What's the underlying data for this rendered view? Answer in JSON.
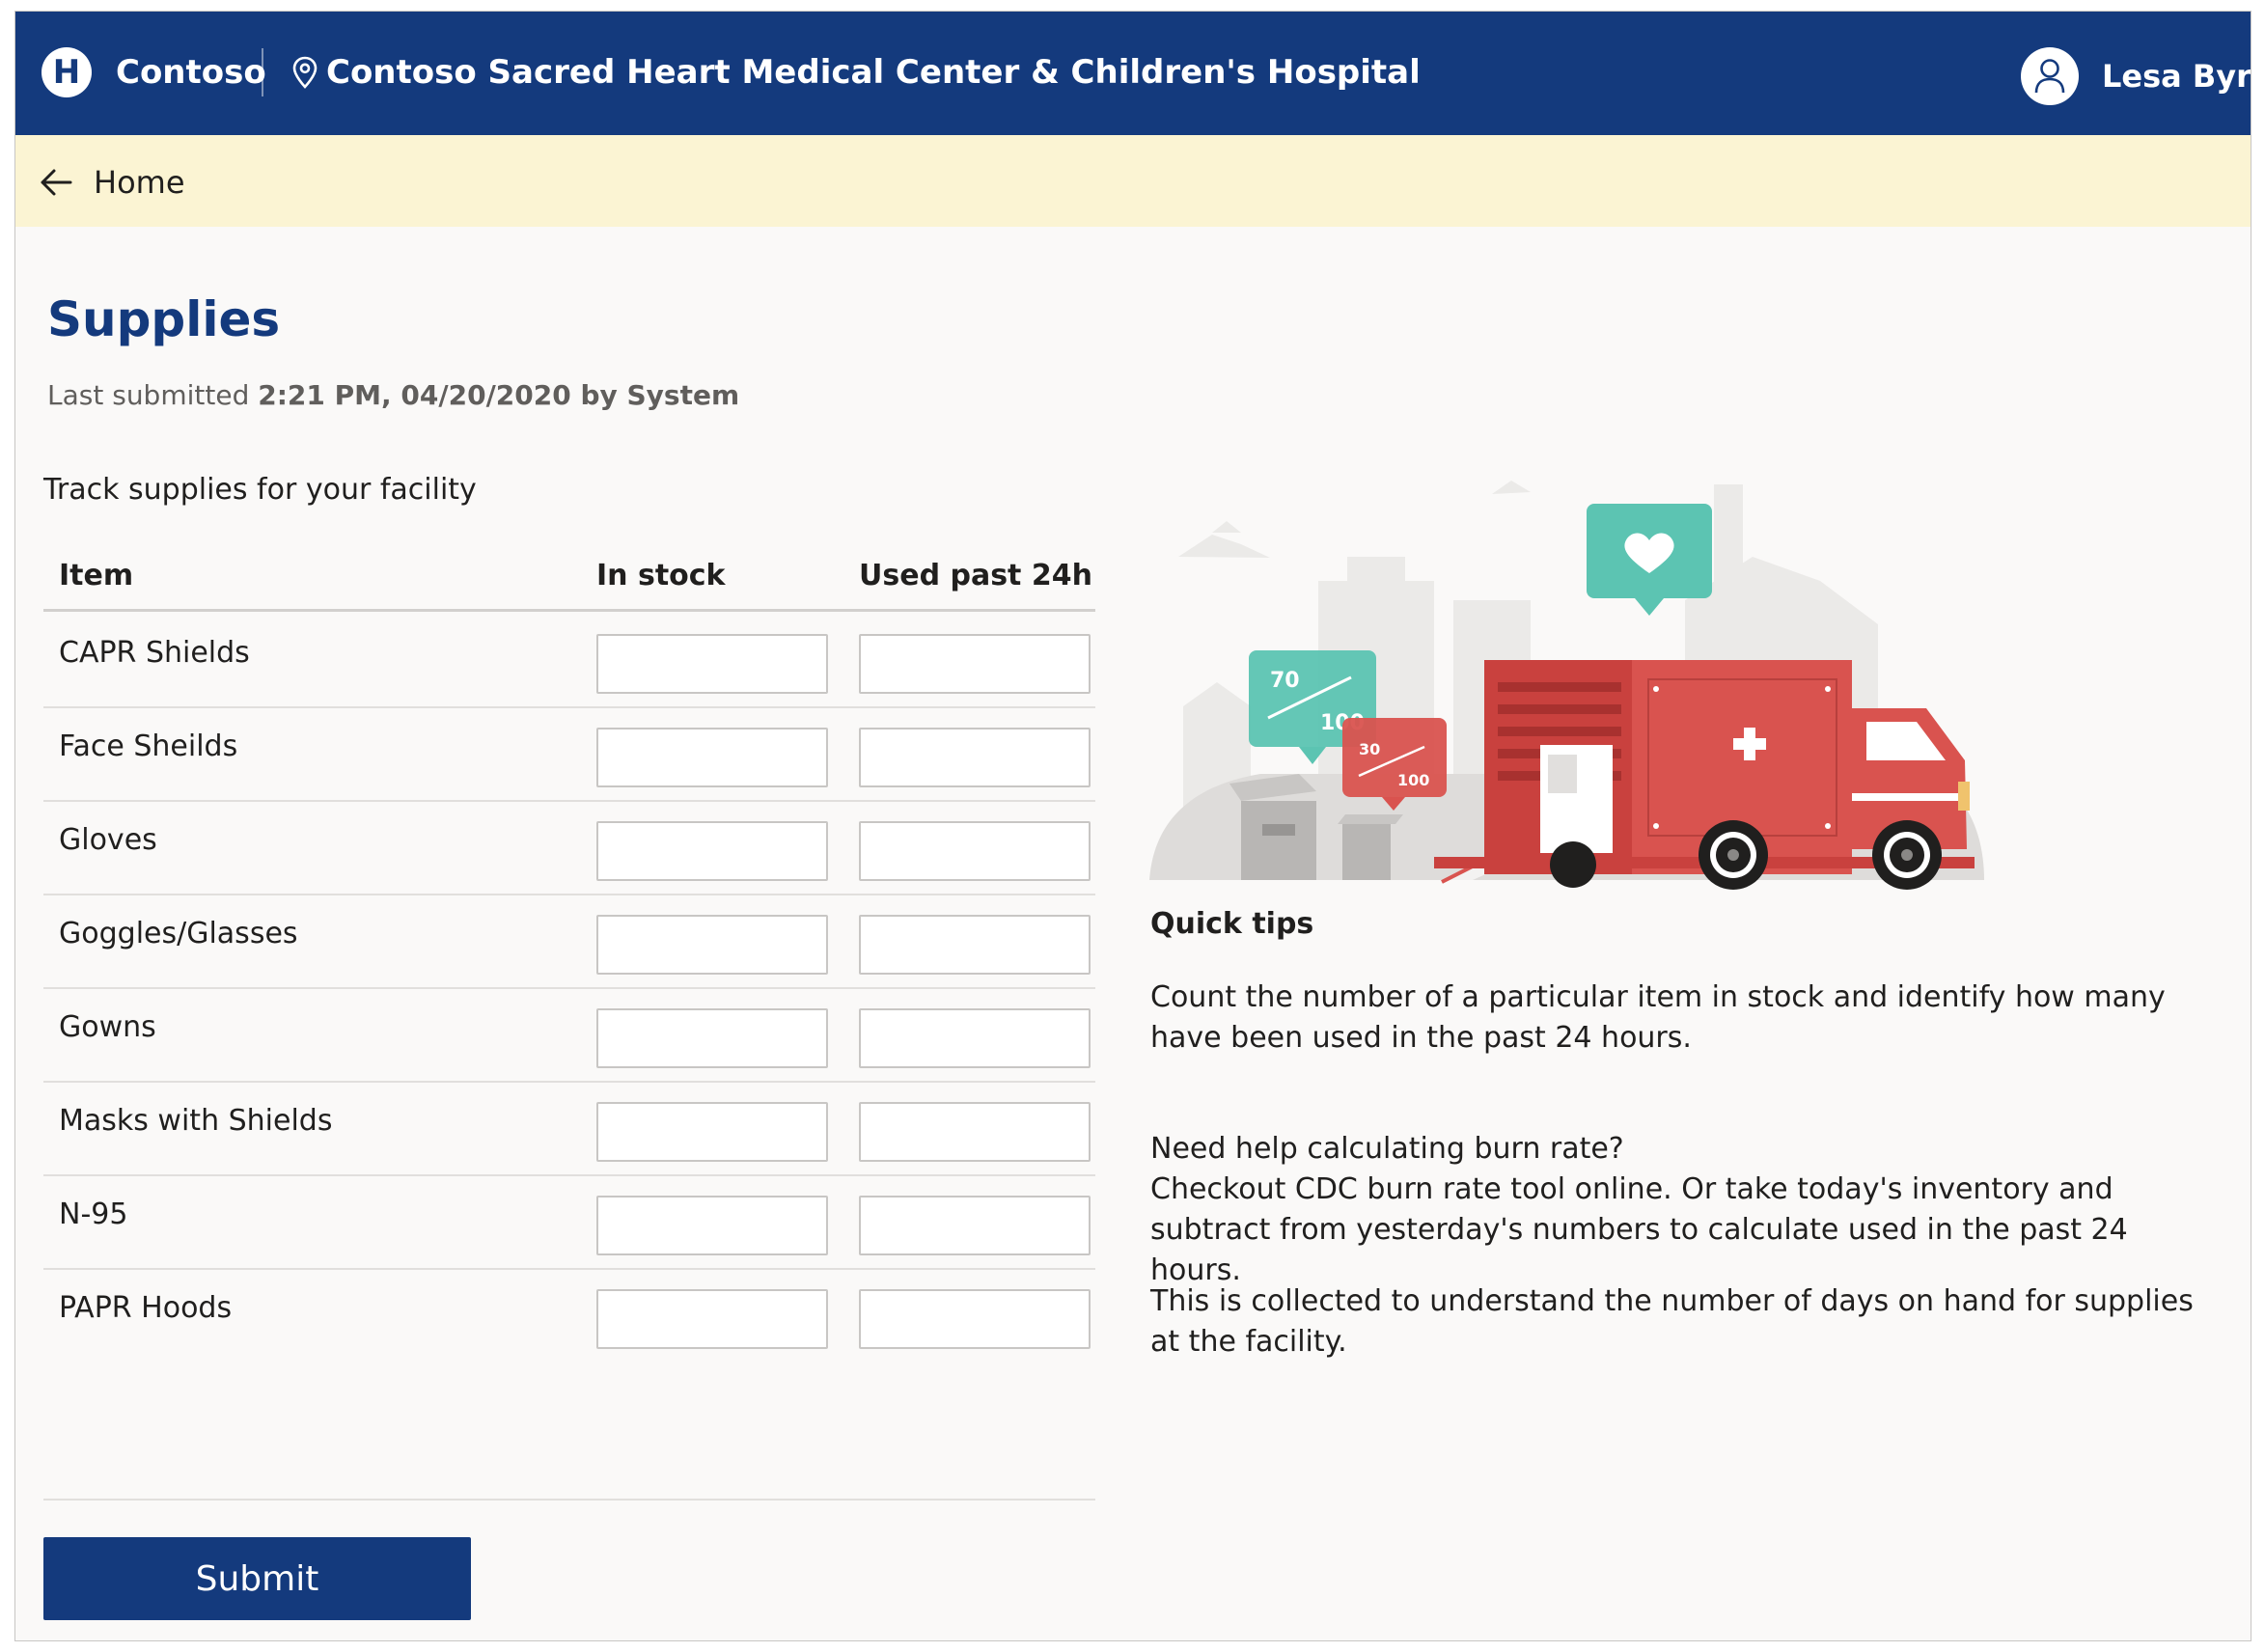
{
  "header": {
    "logo_letter": "H",
    "brand": "Contoso",
    "facility": "Contoso Sacred Heart Medical Center & Children's Hospital",
    "user_name": "Lesa Byrd"
  },
  "breadcrumb": {
    "back_label": "Home"
  },
  "page": {
    "title": "Supplies",
    "last_submitted_prefix": "Last submitted",
    "last_submitted_value": "2:21 PM, 04/20/2020 by System",
    "intro": "Track supplies for your facility"
  },
  "table": {
    "headers": {
      "item": "Item",
      "in_stock": "In stock",
      "used": "Used past 24h"
    },
    "rows": [
      {
        "item": "CAPR Shields",
        "in_stock": "",
        "used": ""
      },
      {
        "item": "Face Sheilds",
        "in_stock": "",
        "used": ""
      },
      {
        "item": "Gloves",
        "in_stock": "",
        "used": ""
      },
      {
        "item": "Goggles/Glasses",
        "in_stock": "",
        "used": ""
      },
      {
        "item": "Gowns",
        "in_stock": "",
        "used": ""
      },
      {
        "item": "Masks with Shields",
        "in_stock": "",
        "used": ""
      },
      {
        "item": "N-95",
        "in_stock": "",
        "used": ""
      },
      {
        "item": "PAPR Hoods",
        "in_stock": "",
        "used": ""
      }
    ]
  },
  "submit_label": "Submit",
  "illustration": {
    "bubble_big_top": "70",
    "bubble_big_bottom": "100",
    "bubble_small_top": "30",
    "bubble_small_bottom": "100"
  },
  "tips": {
    "title": "Quick tips",
    "p1": "Count the number of a particular item in stock and identify how many have been used in the past 24 hours.",
    "p2_line1": "Need help calculating burn rate?",
    "p2_line2": "Checkout CDC burn rate tool online. Or take today's inventory and subtract from yesterday's numbers to calculate used in the past 24 hours.",
    "p3": "This is collected to understand the number of days on hand for supplies at the facility."
  },
  "colors": {
    "brand_blue": "#143a7d",
    "breadcrumb_bg": "#fbf4d3",
    "page_bg": "#faf9f8",
    "truck_red": "#d9534f",
    "bubble_teal": "#5cc4b2"
  },
  "icons": {
    "logo": "hospital-h-icon",
    "location": "map-pin-icon",
    "user": "person-icon",
    "back": "arrow-left-icon"
  }
}
